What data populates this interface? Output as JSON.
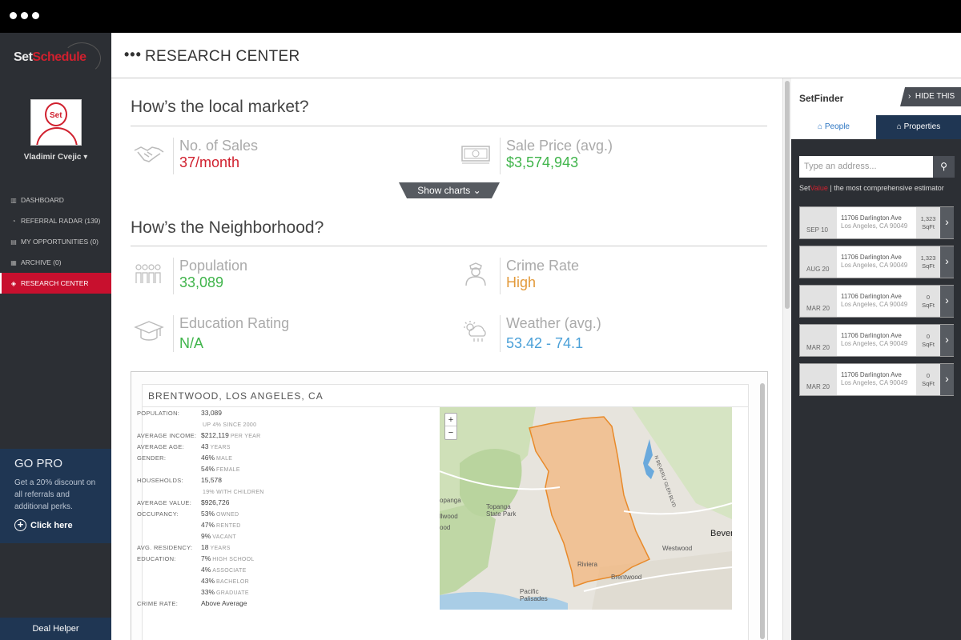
{
  "app": {
    "logo_a": "Set",
    "logo_b": "Schedule",
    "avatar_text": "Set"
  },
  "user": {
    "name": "Vladimir Cvejic"
  },
  "nav": [
    {
      "label": "DASHBOARD",
      "icon": "bar-chart-icon",
      "active": false
    },
    {
      "label": "REFERRAL RADAR (139)",
      "icon": "radar-icon",
      "active": false
    },
    {
      "label": "MY OPPORTUNITIES (0)",
      "icon": "briefcase-icon",
      "active": false
    },
    {
      "label": "ARCHIVE (0)",
      "icon": "archive-icon",
      "active": false
    },
    {
      "label": "RESEARCH CENTER",
      "icon": "tag-icon",
      "active": true
    }
  ],
  "gopro": {
    "title": "GO PRO",
    "text": "Get a 20% discount on all referrals and additional perks.",
    "cta": "Click here"
  },
  "deal_helper": "Deal Helper",
  "header": {
    "title": "RESEARCH CENTER"
  },
  "market": {
    "title": "How’s the local market?",
    "sales_label": "No. of Sales",
    "sales_value": "37/month",
    "price_label": "Sale Price (avg.)",
    "price_value": "$3,574,943",
    "show_charts": "Show charts"
  },
  "neighborhood": {
    "title": "How’s the Neighborhood?",
    "population_label": "Population",
    "population_value": "33,089",
    "crime_label": "Crime Rate",
    "crime_value": "High",
    "education_label": "Education Rating",
    "education_value": "N/A",
    "weather_label": "Weather (avg.)",
    "weather_value": "53.42 - 74.1"
  },
  "detail": {
    "title": "BRENTWOOD, LOS ANGELES, CA",
    "rows": [
      {
        "k": "POPULATION:",
        "v": "33,089",
        "s": ""
      },
      {
        "k": "",
        "v": "",
        "s": "UP 4% SINCE 2000"
      },
      {
        "k": "AVERAGE INCOME:",
        "v": "$212,119",
        "s": "PER YEAR"
      },
      {
        "k": "AVERAGE AGE:",
        "v": "43",
        "s": "YEARS"
      },
      {
        "k": "GENDER:",
        "v": "46%",
        "s": "MALE"
      },
      {
        "k": "",
        "v": "54%",
        "s": "FEMALE"
      },
      {
        "k": "HOUSEHOLDS:",
        "v": "15,578",
        "s": ""
      },
      {
        "k": "",
        "v": "",
        "s": "19% WITH CHILDREN"
      },
      {
        "k": "AVERAGE VALUE:",
        "v": "$926,726",
        "s": ""
      },
      {
        "k": "OCCUPANCY:",
        "v": "53%",
        "s": "OWNED"
      },
      {
        "k": "",
        "v": "47%",
        "s": "RENTED"
      },
      {
        "k": "",
        "v": "9%",
        "s": "VACANT"
      },
      {
        "k": "AVG. RESIDENCY:",
        "v": "18",
        "s": "YEARS"
      },
      {
        "k": "EDUCATION:",
        "v": "7%",
        "s": "HIGH SCHOOL"
      },
      {
        "k": "",
        "v": "4%",
        "s": "ASSOCIATE"
      },
      {
        "k": "",
        "v": "43%",
        "s": "BACHELOR"
      },
      {
        "k": "",
        "v": "33%",
        "s": "GRADUATE"
      },
      {
        "k": "CRIME RATE:",
        "v": "Above Average",
        "s": ""
      }
    ]
  },
  "map": {
    "zoom_in": "+",
    "zoom_out": "−",
    "labels": [
      "Topanga State Park",
      "opanga",
      "llwood",
      "ood",
      "Bever",
      "Westwood",
      "Brentwood",
      "Pacific Palisades",
      "N BEVERLY GLEN BLVD",
      "Riviera"
    ]
  },
  "setfinder": {
    "title": "SetFinder",
    "hide": "HIDE THIS",
    "tab_people": "People",
    "tab_properties": "Properties",
    "search_placeholder": "Type an address...",
    "tag_a": "Set",
    "tag_b": "Value",
    "tag_c": " | the most comprehensive estimator",
    "cards": [
      {
        "date": "SEP 10",
        "street": "11706 Darlington Ave",
        "city": "Los Angeles, CA 90049",
        "sq": "1,323",
        "unit": "SqFt"
      },
      {
        "date": "AUG 20",
        "street": "11706 Darlington Ave",
        "city": "Los Angeles, CA 90049",
        "sq": "1,323",
        "unit": "SqFt"
      },
      {
        "date": "MAR 20",
        "street": "11706 Darlington Ave",
        "city": "Los Angeles, CA 90049",
        "sq": "0",
        "unit": "SqFt"
      },
      {
        "date": "MAR 20",
        "street": "11706 Darlington Ave",
        "city": "Los Angeles, CA 90049",
        "sq": "0",
        "unit": "SqFt"
      },
      {
        "date": "MAR 20",
        "street": "11706 Darlington Ave",
        "city": "Los Angeles, CA 90049",
        "sq": "0",
        "unit": "SqFt"
      }
    ]
  }
}
